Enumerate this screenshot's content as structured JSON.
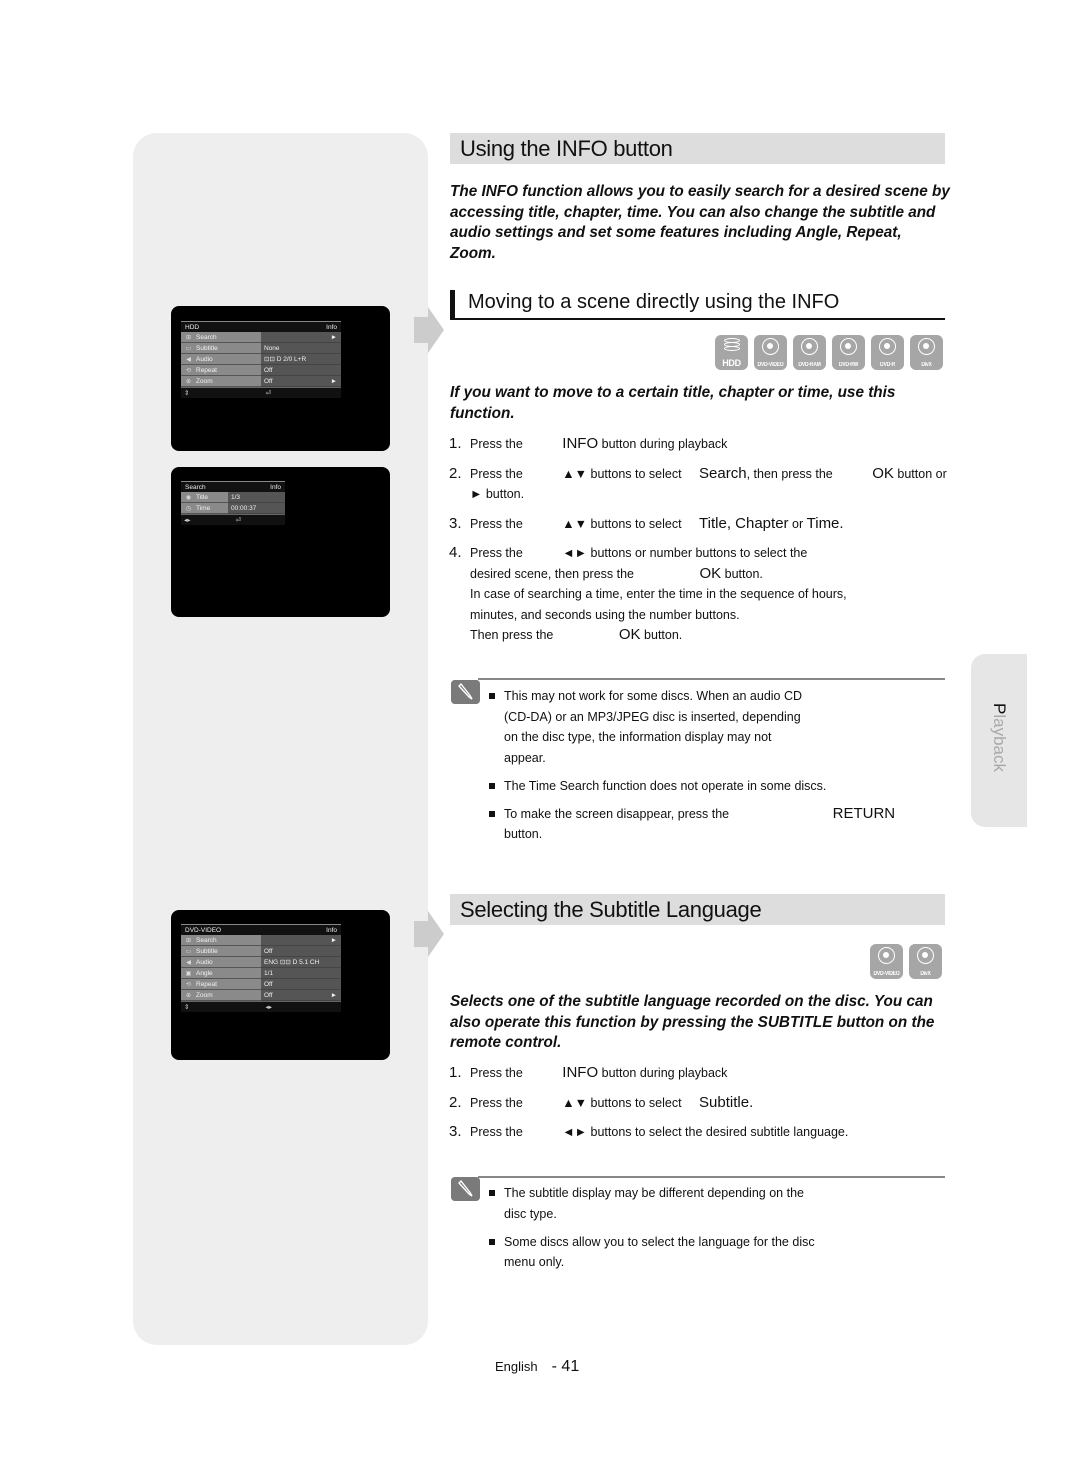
{
  "sidebar": {
    "screens": [
      {
        "header_left": "HDD",
        "header_right": "Info",
        "rows": [
          {
            "icon": "search-icon",
            "label": "Search",
            "value": "",
            "arrow": "►",
            "selected": true
          },
          {
            "icon": "subtitle-icon",
            "label": "Subtitle",
            "value": "None",
            "arrow": ""
          },
          {
            "icon": "audio-icon",
            "label": "Audio",
            "value": "⊡⊡ D 2/0 L+R",
            "arrow": ""
          },
          {
            "icon": "repeat-icon",
            "label": "Repeat",
            "value": "Off",
            "arrow": ""
          },
          {
            "icon": "zoom-icon",
            "label": "Zoom",
            "value": "Off",
            "arrow": "►"
          }
        ],
        "footer_left": "⇕",
        "footer_right": "⏎"
      },
      {
        "header_left": "Search",
        "header_right": "Info",
        "rows": [
          {
            "icon": "title-icon",
            "label": "Title",
            "value": "1/3",
            "selected": true
          },
          {
            "icon": "time-icon",
            "label": "Time",
            "value": "00:00:37"
          }
        ],
        "footer_left": "◂▸",
        "footer_right": "⏎"
      },
      {
        "header_left": "DVD-VIDEO",
        "header_right": "Info",
        "rows": [
          {
            "icon": "search-icon",
            "label": "Search",
            "value": "",
            "arrow": "►"
          },
          {
            "icon": "subtitle-icon",
            "label": "Subtitle",
            "value": "Off",
            "arrow": "",
            "selected": true
          },
          {
            "icon": "audio-icon",
            "label": "Audio",
            "value": "ENG ⊡⊡ D 5.1 CH",
            "arrow": ""
          },
          {
            "icon": "angle-icon",
            "label": "Angle",
            "value": "1/1",
            "arrow": ""
          },
          {
            "icon": "repeat-icon",
            "label": "Repeat",
            "value": "Off",
            "arrow": ""
          },
          {
            "icon": "zoom-icon",
            "label": "Zoom",
            "value": "Off",
            "arrow": "►"
          }
        ],
        "footer_left": "⇕",
        "footer_right": "◂▸"
      }
    ]
  },
  "section1": {
    "title": "Using the INFO button",
    "intro": "The INFO function allows you to easily search for a desired scene by accessing title, chapter, time. You can also change the subtitle and audio settings and set some features including Angle, Repeat, Zoom.",
    "subsection_title": "Moving to a scene directly using the INFO",
    "disc_types": [
      "HDD",
      "DVD-VIDEO",
      "DVD-RAM",
      "DVD-RW",
      "DVD-R",
      "DivX"
    ],
    "sub_intro": "If you want to move to a certain title, chapter or time, use this function.",
    "steps": [
      {
        "num": "1.",
        "a": "Press the",
        "key": "INFO",
        "b": "button during playback"
      },
      {
        "num": "2.",
        "a": "Press the",
        "arrows": "▲▼",
        "b": "buttons to select",
        "key": "Search",
        "c": ", then press the",
        "key2": "OK",
        "d": "button or ► button."
      },
      {
        "num": "3.",
        "a": "Press the",
        "arrows": "▲▼",
        "b": "buttons to select",
        "key": "Title, Chapter",
        "c": "or",
        "key2": "Time."
      },
      {
        "num": "4.",
        "a": "Press the",
        "arrows": "◄►",
        "b": "buttons or number buttons to select the desired scene, then press the",
        "key": "OK",
        "c": "button.",
        "d": "In case of searching a time, enter the time in the sequence of hours, minutes, and seconds using the number buttons.",
        "e": "Then press the",
        "key2": "OK",
        "f": "button."
      }
    ],
    "notes": [
      "This may not work for some discs. When an audio CD (CD-DA) or an MP3/JPEG disc is inserted, depending on the disc type, the information display may not appear.",
      "The Time Search function does not operate in some discs.",
      {
        "a": "To make the screen disappear, press the",
        "key": "RETURN",
        "b": "button."
      }
    ]
  },
  "section2": {
    "title": "Selecting the Subtitle Language",
    "disc_types": [
      "DVD-VIDEO",
      "DivX"
    ],
    "intro": "Selects one of the subtitle language recorded on the disc. You can also operate this function by pressing the SUBTITLE button on the remote control.",
    "steps": [
      {
        "num": "1.",
        "a": "Press the",
        "key": "INFO",
        "b": "button during playback"
      },
      {
        "num": "2.",
        "a": "Press the",
        "arrows": "▲▼",
        "b": "buttons to select",
        "key": "Subtitle."
      },
      {
        "num": "3.",
        "a": "Press the",
        "arrows": "◄►",
        "b": "buttons to select the desired subtitle language."
      }
    ],
    "notes": [
      "The subtitle display may be different depending on the disc type.",
      "Some discs allow you to select the language for the disc menu only."
    ]
  },
  "side_tab": {
    "first_letter": "P",
    "rest": "layback"
  },
  "footer": {
    "language": "English",
    "page": "- 41"
  }
}
